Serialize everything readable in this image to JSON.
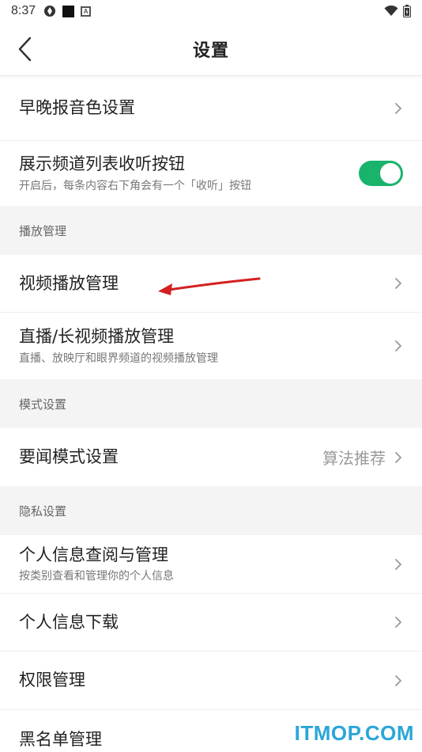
{
  "status_bar": {
    "time": "8:37",
    "badge_letter": "A"
  },
  "header": {
    "title": "设置"
  },
  "rows_top": [
    {
      "title": "早晚报音色设置"
    },
    {
      "title": "展示频道列表收听按钮",
      "subtitle": "开启后，每条内容右下角会有一个「收听」按钮",
      "toggle_on": true
    }
  ],
  "sections": [
    {
      "header": "播放管理",
      "rows": [
        {
          "title": "视频播放管理"
        },
        {
          "title": "直播/长视频播放管理",
          "subtitle": "直播、放映厅和眼界频道的视频播放管理"
        }
      ]
    },
    {
      "header": "模式设置",
      "rows": [
        {
          "title": "要闻模式设置",
          "value": "算法推荐"
        }
      ]
    },
    {
      "header": "隐私设置",
      "rows": [
        {
          "title": "个人信息查阅与管理",
          "subtitle": "按类别查看和管理你的个人信息"
        },
        {
          "title": "个人信息下载"
        },
        {
          "title": "权限管理"
        },
        {
          "title": "黑名单管理"
        }
      ]
    }
  ],
  "colors": {
    "toggle_on": "#19b36b",
    "annotation_arrow": "#d42020",
    "watermark": "#2aa6d8"
  },
  "watermark": "ITMOP.COM"
}
